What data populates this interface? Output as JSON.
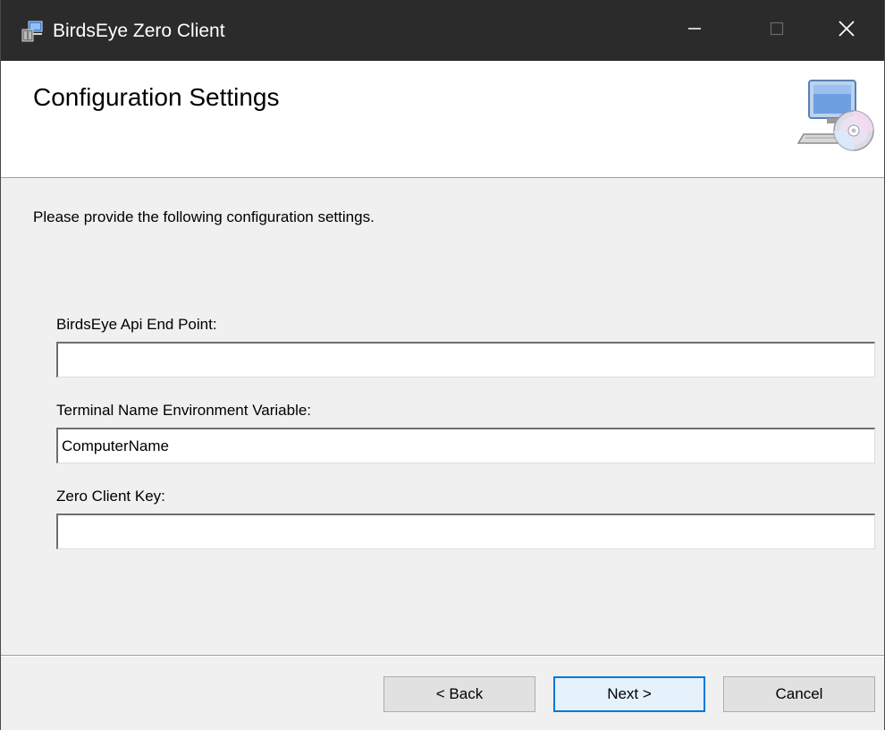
{
  "window": {
    "title": "BirdsEye Zero Client",
    "controls": {
      "minimize_icon": "minimize-icon",
      "maximize_icon": "maximize-icon",
      "close_icon": "close-icon"
    }
  },
  "banner": {
    "title": "Configuration Settings",
    "icon": "computer-cd-icon"
  },
  "body": {
    "intro": "Please provide the following configuration settings.",
    "fields": [
      {
        "label": "BirdsEye Api End Point:",
        "value": ""
      },
      {
        "label": "Terminal Name Environment Variable:",
        "value": "ComputerName"
      },
      {
        "label": "Zero Client Key:",
        "value": ""
      }
    ]
  },
  "buttons": {
    "back": "< Back",
    "next": "Next >",
    "cancel": "Cancel"
  },
  "colors": {
    "titlebar": "#2b2b2b",
    "dialog_background": "#f0f0f0",
    "banner_background": "#ffffff",
    "default_button_accent": "#0078d7"
  }
}
